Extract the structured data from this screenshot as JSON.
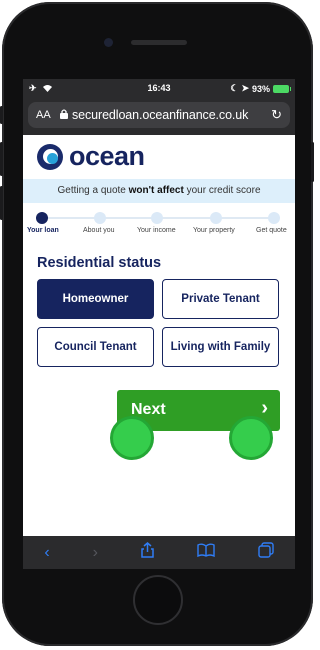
{
  "status": {
    "time": "16:43",
    "battery": "93%"
  },
  "browser": {
    "text_size_label": "AA",
    "url": "securedloan.oceanfinance.co.uk"
  },
  "brand": {
    "name": "ocean"
  },
  "banner": {
    "prefix": "Getting a quote ",
    "emphasis": "won't affect",
    "suffix": " your credit score"
  },
  "steps": [
    "Your loan",
    "About you",
    "Your income",
    "Your property",
    "Get quote"
  ],
  "section": {
    "title": "Residential status"
  },
  "options": [
    "Homeowner",
    "Private Tenant",
    "Council Tenant",
    "Living with Family"
  ],
  "selected_option": "Homeowner",
  "next": {
    "label": "Next",
    "arrow": "›"
  },
  "colors": {
    "navy": "#16245f",
    "green": "#2f9e25",
    "banner": "#ddeffb",
    "touch": "#35cd4c"
  },
  "icons": [
    "airplane-icon",
    "wifi-icon",
    "lock-icon",
    "reload-icon",
    "back-icon",
    "forward-icon",
    "share-icon",
    "bookmarks-icon",
    "tabs-icon"
  ]
}
